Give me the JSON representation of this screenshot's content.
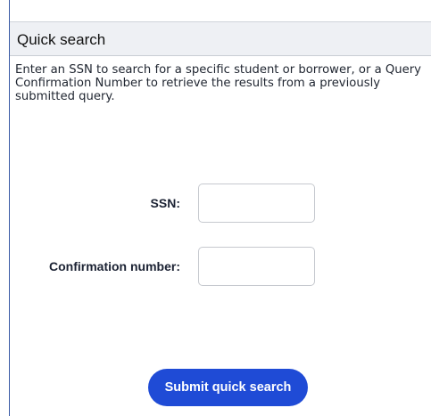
{
  "header": {
    "title": "Quick search"
  },
  "description": "Enter an SSN to search for a specific student or borrower, or a Query Confirmation Number to retrieve the results from a previously submitted query.",
  "form": {
    "ssn_label": "SSN:",
    "ssn_value": "",
    "confirmation_label": "Confirmation number:",
    "confirmation_value": ""
  },
  "submit_label": "Submit quick search",
  "colors": {
    "accent": "#1f4bd6",
    "panel_border": "#3a5ba6",
    "header_bg": "#eef0f4"
  }
}
